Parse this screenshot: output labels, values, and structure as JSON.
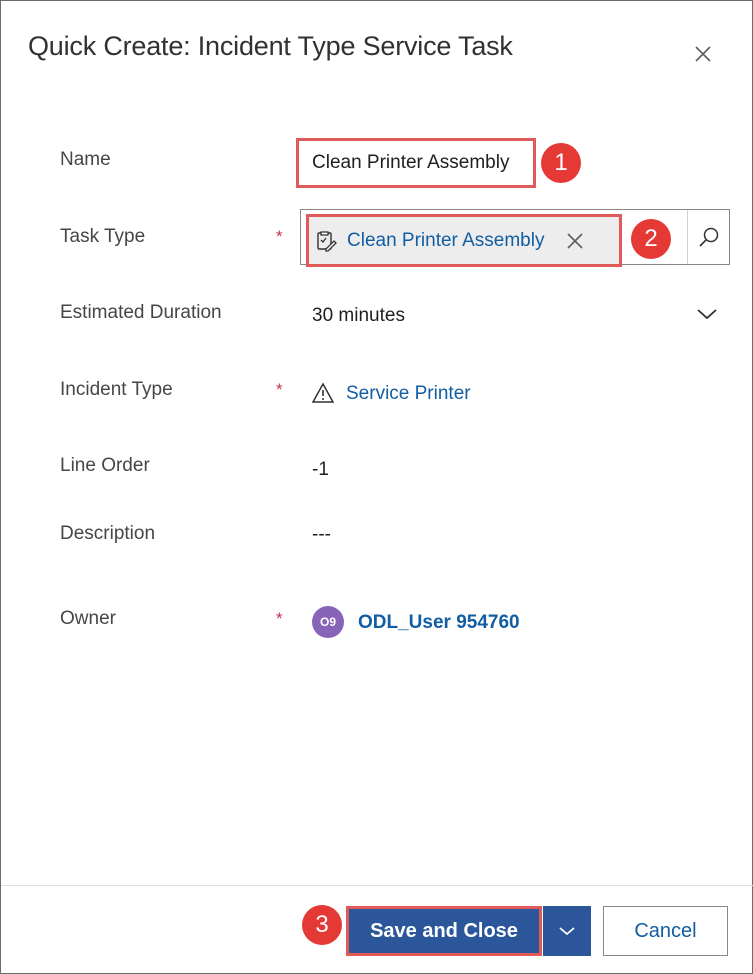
{
  "dialog": {
    "title": "Quick Create: Incident Type Service Task",
    "close_icon": "close-icon"
  },
  "form": {
    "name": {
      "label": "Name",
      "value": "Clean Printer Assembly"
    },
    "task_type": {
      "label": "Task Type",
      "required": "*",
      "value": "Clean Printer Assembly",
      "icon": "task-type-icon",
      "search_icon": "search-icon"
    },
    "estimated_duration": {
      "label": "Estimated Duration",
      "value": "30 minutes"
    },
    "incident_type": {
      "label": "Incident Type",
      "required": "*",
      "value": "Service Printer",
      "icon": "warning-icon"
    },
    "line_order": {
      "label": "Line Order",
      "value": "-1"
    },
    "description": {
      "label": "Description",
      "value": "---"
    },
    "owner": {
      "label": "Owner",
      "required": "*",
      "initials": "O9",
      "value": "ODL_User 954760"
    }
  },
  "callouts": [
    "1",
    "2",
    "3"
  ],
  "footer": {
    "save_label": "Save and Close",
    "cancel_label": "Cancel"
  },
  "colors": {
    "primary": "#2b579a",
    "link": "#115ea3",
    "highlight": "#e05a5a",
    "callout": "#e53935",
    "avatar": "#8764b8",
    "required": "#c4314b"
  }
}
